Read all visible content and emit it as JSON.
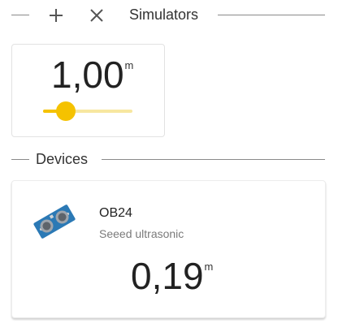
{
  "header": {
    "title": "Simulators",
    "collapse_icon": "minus-icon",
    "add_icon": "plus-icon",
    "close_icon": "close-icon"
  },
  "simulator": {
    "value": "1,00",
    "unit": "m",
    "slider_fraction": 0.25,
    "accent_color": "#f5c200",
    "track_color": "#f7e7a0"
  },
  "devices": {
    "title": "Devices",
    "items": [
      {
        "name": "OB24",
        "type": "Seeed ultrasonic",
        "value": "0,19",
        "unit": "m",
        "icon": "ultrasonic-sensor-icon"
      }
    ]
  }
}
